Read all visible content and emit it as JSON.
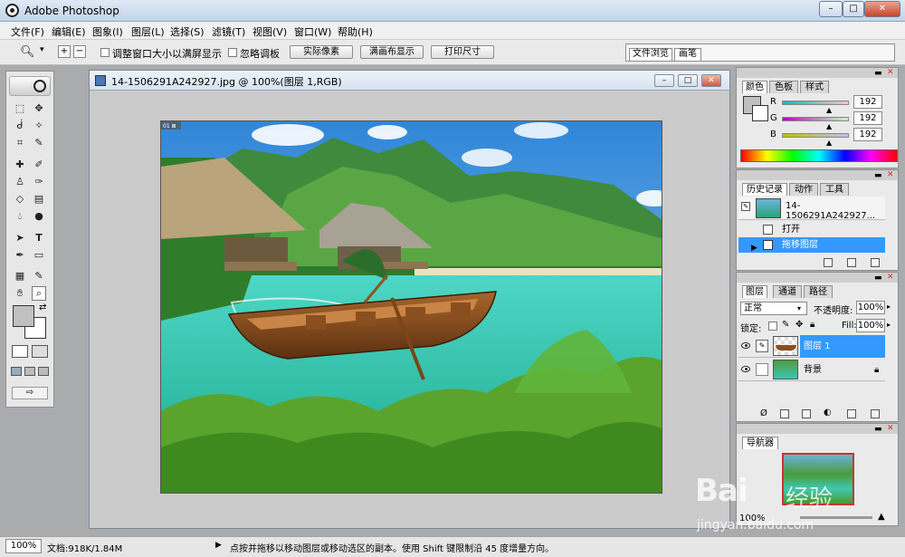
{
  "app": {
    "title": "Adobe Photoshop"
  },
  "window_controls": {
    "minimize": "–",
    "maximize": "□",
    "close": "✕"
  },
  "menubar": {
    "items": [
      "文件(F)",
      "编辑(E)",
      "图象(I)",
      "图层(L)",
      "选择(S)",
      "滤镜(T)",
      "视图(V)",
      "窗口(W)",
      "帮助(H)"
    ]
  },
  "options": {
    "tool_icon": "zoom-icon",
    "resize_window_label": "调整窗口大小以满屏显示",
    "ignore_palettes_label": "忽略调板",
    "actual_pixels": "实际像素",
    "fit_on_screen": "满画布显示",
    "print_size": "打印尺寸"
  },
  "palette_well": {
    "tabs": [
      "文件浏览",
      "画笔"
    ]
  },
  "document": {
    "title": "14-1506291A242927.jpg @ 100%(图层 1,RGB)",
    "corner_badge": "01 ⊠"
  },
  "color_panel": {
    "tabs": [
      "颜色",
      "色板",
      "样式"
    ],
    "channels": [
      {
        "label": "R",
        "value": "192"
      },
      {
        "label": "G",
        "value": "192"
      },
      {
        "label": "B",
        "value": "192"
      }
    ]
  },
  "history_panel": {
    "tabs": [
      "历史记录",
      "动作",
      "工具"
    ],
    "snapshot": "14-1506291A242927...",
    "states": [
      "打开",
      "拖移图层"
    ]
  },
  "layers_panel": {
    "tabs": [
      "图层",
      "通道",
      "路径"
    ],
    "blend_mode": "正常",
    "opacity_label": "不透明度:",
    "opacity_value": "100%",
    "lock_label": "锁定:",
    "fill_label": "Fill:",
    "fill_value": "100%",
    "layers": [
      {
        "name": "图层 1",
        "selected": true
      },
      {
        "name": "背景",
        "selected": false
      }
    ]
  },
  "navigator_panel": {
    "tabs": [
      "导航器"
    ],
    "zoom": "100%"
  },
  "status": {
    "zoom": "100%",
    "doc_size": "文档:918K/1.84M",
    "hint": "点按并拖移以移动图层或移动选区的副本。使用 Shift 键限制沿 45 度增量方向。"
  },
  "watermark": {
    "brand": "Bai",
    "brand_cn": "经验",
    "url": "jingyan.baidu.com"
  },
  "colors": {
    "accent": "#3399ff",
    "title_gradient": "#c2d5ea",
    "close_red": "#c7452b"
  }
}
